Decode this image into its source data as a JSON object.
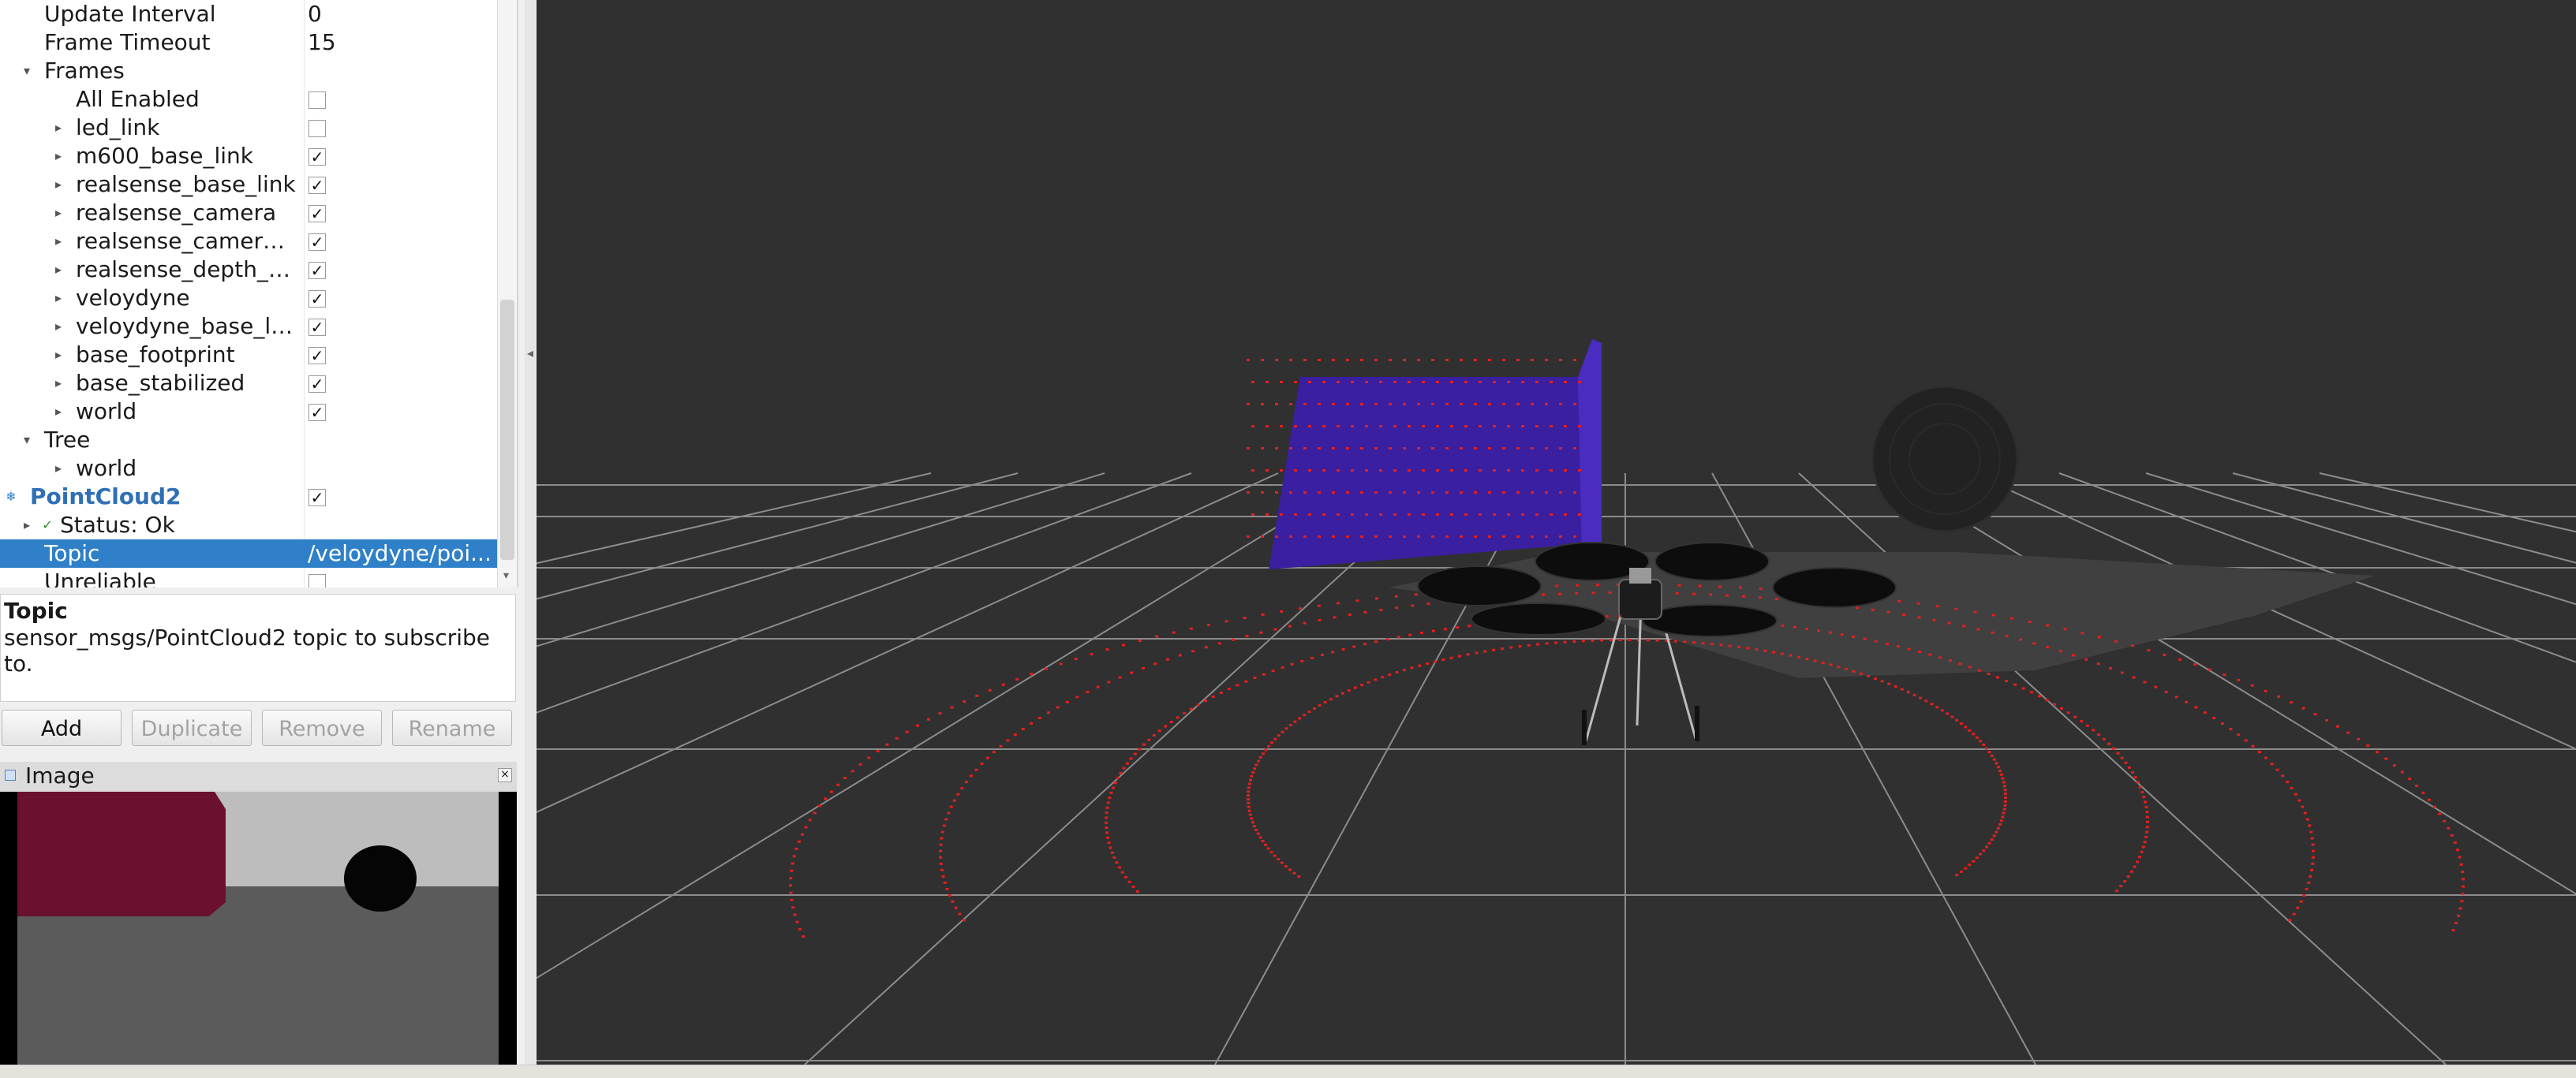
{
  "displays": {
    "rows": [
      {
        "name": "Update Interval",
        "value": "0",
        "indent": 1,
        "arrow": "none",
        "check": null
      },
      {
        "name": "Frame Timeout",
        "value": "15",
        "indent": 1,
        "arrow": "none",
        "check": null
      },
      {
        "name": "Frames",
        "value": "",
        "indent": 1,
        "arrow": "down",
        "check": null
      },
      {
        "name": "All Enabled",
        "value": "",
        "indent": 2,
        "arrow": "none",
        "check": false
      },
      {
        "name": "led_link",
        "value": "",
        "indent": 2,
        "arrow": "right",
        "check": false
      },
      {
        "name": "m600_base_link",
        "value": "",
        "indent": 2,
        "arrow": "right",
        "check": true
      },
      {
        "name": "realsense_base_link",
        "value": "",
        "indent": 2,
        "arrow": "right",
        "check": true
      },
      {
        "name": "realsense_camera",
        "value": "",
        "indent": 2,
        "arrow": "right",
        "check": true
      },
      {
        "name": "realsense_camera_...",
        "value": "",
        "indent": 2,
        "arrow": "right",
        "check": true
      },
      {
        "name": "realsense_depth_o...",
        "value": "",
        "indent": 2,
        "arrow": "right",
        "check": true
      },
      {
        "name": "veloydyne",
        "value": "",
        "indent": 2,
        "arrow": "right",
        "check": true
      },
      {
        "name": "veloydyne_base_link",
        "value": "",
        "indent": 2,
        "arrow": "right",
        "check": true
      },
      {
        "name": "base_footprint",
        "value": "",
        "indent": 2,
        "arrow": "right",
        "check": true
      },
      {
        "name": "base_stabilized",
        "value": "",
        "indent": 2,
        "arrow": "right",
        "check": true
      },
      {
        "name": "world",
        "value": "",
        "indent": 2,
        "arrow": "right",
        "check": true
      },
      {
        "name": "Tree",
        "value": "",
        "indent": 1,
        "arrow": "down",
        "check": null
      },
      {
        "name": "world",
        "value": "",
        "indent": 2,
        "arrow": "right",
        "check": null
      },
      {
        "name": "PointCloud2",
        "value": "",
        "indent": 0,
        "arrow": "none",
        "check": true,
        "display": true
      },
      {
        "name": "Status: Ok",
        "value": "",
        "indent": 1,
        "arrow": "right",
        "check": null,
        "status": true
      },
      {
        "name": "Topic",
        "value": "/veloydyne/poi...",
        "indent": 1,
        "arrow": "none",
        "check": null,
        "selected": true
      },
      {
        "name": "Unreliable",
        "value": "",
        "indent": 1,
        "arrow": "none",
        "check": false
      }
    ]
  },
  "description": {
    "title": "Topic",
    "body": "sensor_msgs/PointCloud2 topic to subscribe to."
  },
  "buttons": {
    "add": "Add",
    "duplicate": "Duplicate",
    "remove": "Remove",
    "rename": "Rename"
  },
  "image_panel": {
    "title": "Image"
  },
  "icons": {
    "check": "checkmark-icon",
    "expand": "triangle-right-icon",
    "collapse": "triangle-down-icon",
    "close": "close-icon",
    "dock": "dock-icon"
  },
  "colors": {
    "selection": "#2f80c8",
    "display_name": "#2f6fb5",
    "viewport_bg": "#303030",
    "grid": "#8c8c8c",
    "laser_points": "#e02020",
    "wall": "#3a1fa0"
  }
}
